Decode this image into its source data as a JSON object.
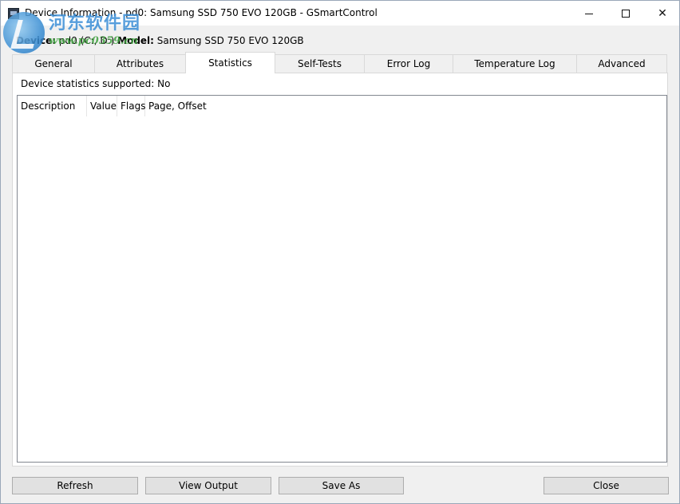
{
  "window": {
    "title": "Device Information - pd0: Samsung SSD 750 EVO 120GB - GSmartControl",
    "controls": {
      "minimize": "minimize",
      "maximize": "maximize",
      "close": "✕"
    }
  },
  "watermark": {
    "text": "河东软件园",
    "url": "www.pc0359.cn"
  },
  "device_info": {
    "device_label": "Device:",
    "device_value": "pd0 (C:, D:)",
    "model_label": "Model:",
    "model_value": "Samsung SSD 750 EVO 120GB"
  },
  "tabs": [
    {
      "label": "General"
    },
    {
      "label": "Attributes"
    },
    {
      "label": "Statistics"
    },
    {
      "label": "Self-Tests"
    },
    {
      "label": "Error Log"
    },
    {
      "label": "Temperature Log"
    },
    {
      "label": "Advanced"
    }
  ],
  "active_tab": "Statistics",
  "statistics": {
    "supported_text": "Device statistics supported: No",
    "columns": [
      "Description",
      "Value",
      "Flags",
      "Page, Offset"
    ],
    "rows": []
  },
  "buttons": {
    "refresh": "Refresh",
    "view_output": "View Output",
    "save_as": "Save As",
    "close": "Close"
  }
}
